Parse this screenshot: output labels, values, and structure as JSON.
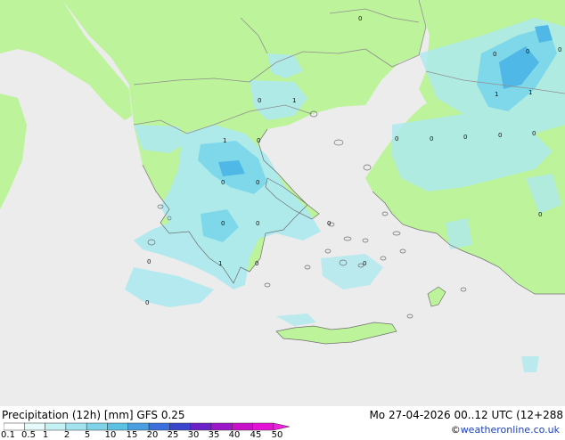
{
  "map": {
    "colors": {
      "sea": "#ececec",
      "land": "#bdf39a",
      "precip_light": "#aee9ef",
      "precip_mid": "#7fd8ea",
      "precip_heavy": "#4fb8e6",
      "border": "#8f8f8f"
    },
    "point_values": [
      "0",
      "0",
      "0",
      "0",
      "1",
      "1",
      "0",
      "1",
      "1",
      "0",
      "0",
      "0",
      "0",
      "0",
      "0",
      "0",
      "0",
      "0",
      "0",
      "0",
      "0",
      "0",
      "1",
      "0",
      "0",
      "0",
      "1",
      "0"
    ]
  },
  "footer": {
    "title": "Precipitation (12h) [mm] GFS 0.25",
    "datetime": "Mo 27-04-2026 00..12 UTC (12+288",
    "credit_prefix": "©",
    "credit_brand": "weatheronline.co.uk"
  },
  "legend": {
    "labels": [
      "0.1",
      "0.5",
      "1",
      "2",
      "5",
      "10",
      "15",
      "20",
      "25",
      "30",
      "35",
      "40",
      "45",
      "50"
    ],
    "colors": [
      "#ffffff",
      "#e6f9fb",
      "#c5f0f4",
      "#a2e3ee",
      "#7ed3e8",
      "#5cc1e2",
      "#4a9fe0",
      "#3b6fdc",
      "#3a46cc",
      "#6a22c8",
      "#9a18c8",
      "#c810c8",
      "#e412d6",
      "#f020e0"
    ]
  }
}
